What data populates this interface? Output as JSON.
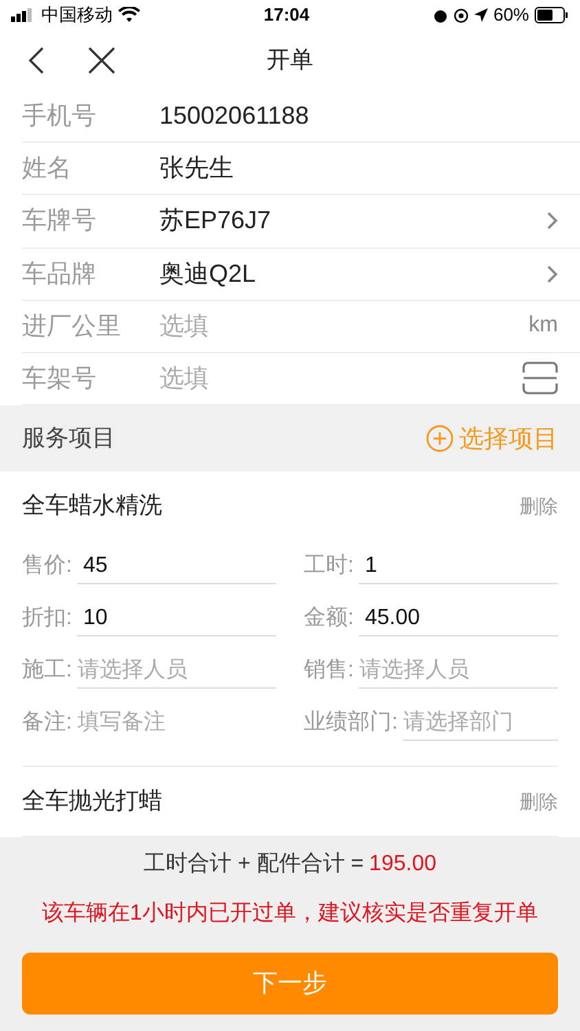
{
  "status_bar": {
    "carrier": "中国移动",
    "time": "17:04",
    "battery": "60%"
  },
  "nav": {
    "title": "开单"
  },
  "form_rows": [
    {
      "kind": "text",
      "label": "手机号",
      "value": "15002061188"
    },
    {
      "kind": "text",
      "label": "姓名",
      "value": "张先生"
    },
    {
      "kind": "select",
      "label": "车牌号",
      "value": "苏EP76J7"
    },
    {
      "kind": "select",
      "label": "车品牌",
      "value": "奥迪Q2L"
    },
    {
      "kind": "unit",
      "label": "进厂公里",
      "placeholder": "选填",
      "unit": "km"
    },
    {
      "kind": "scan",
      "label": "车架号",
      "placeholder": "选填"
    }
  ],
  "services": {
    "title": "服务项目",
    "add_label": "选择项目",
    "items": [
      {
        "name": "全车蜡水精洗",
        "delete": "删除",
        "fields": [
          {
            "label": "售价:",
            "value": "45",
            "underlined": true
          },
          {
            "label": "工时:",
            "value": "1",
            "underlined": true
          },
          {
            "label": "折扣:",
            "value": "10",
            "underlined": true
          },
          {
            "label": "金额:",
            "value": "45.00",
            "underlined": true
          },
          {
            "label": "施工:",
            "placeholder": "请选择人员",
            "underlined": true
          },
          {
            "label": "销售:",
            "placeholder": "请选择人员",
            "underlined": true
          },
          {
            "label": "备注:",
            "placeholder": "填写备注",
            "underlined": false
          },
          {
            "label": "业绩部门:",
            "placeholder": "请选择部门",
            "underlined": true
          }
        ]
      },
      {
        "name": "全车抛光打蜡",
        "delete": "删除"
      }
    ]
  },
  "footer": {
    "summary": "工时合计 + 配件合计 =",
    "total": "195.00",
    "warning": "该车辆在1小时内已开过单，建议核实是否重复开单",
    "next_button": "下一步"
  }
}
